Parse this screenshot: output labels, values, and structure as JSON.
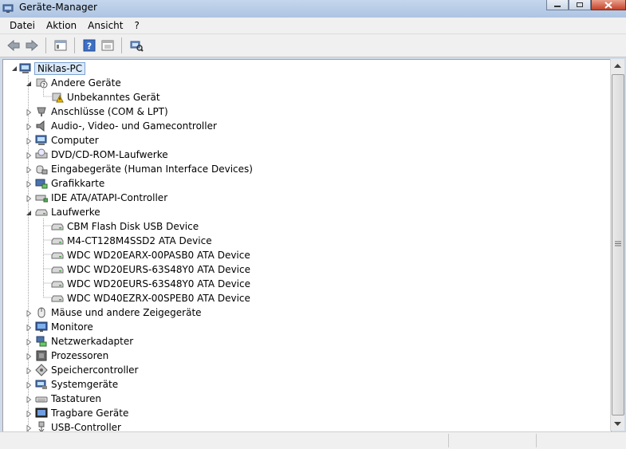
{
  "window": {
    "title": "Geräte-Manager"
  },
  "menu": [
    "Datei",
    "Aktion",
    "Ansicht",
    "?"
  ],
  "toolbar": {
    "buttons": [
      "back-icon",
      "forward-icon",
      "properties-icon",
      "help-icon",
      "show-hidden-icon",
      "scan-hardware-icon"
    ]
  },
  "tree": {
    "root": "Niklas-PC",
    "items": [
      {
        "label": "Andere Geräte",
        "level": 1,
        "expanded": true,
        "icon": "unknown-device-icon"
      },
      {
        "label": "Unbekanntes Gerät",
        "level": 2,
        "icon": "warning-device-icon"
      },
      {
        "label": "Anschlüsse (COM & LPT)",
        "level": 1,
        "expanded": false,
        "icon": "port-icon"
      },
      {
        "label": "Audio-, Video- und Gamecontroller",
        "level": 1,
        "expanded": false,
        "icon": "speaker-icon"
      },
      {
        "label": "Computer",
        "level": 1,
        "expanded": false,
        "icon": "computer-icon"
      },
      {
        "label": "DVD/CD-ROM-Laufwerke",
        "level": 1,
        "expanded": false,
        "icon": "dvd-drive-icon"
      },
      {
        "label": "Eingabegeräte (Human Interface Devices)",
        "level": 1,
        "expanded": false,
        "icon": "hid-icon"
      },
      {
        "label": "Grafikkarte",
        "level": 1,
        "expanded": false,
        "icon": "display-adapter-icon"
      },
      {
        "label": "IDE ATA/ATAPI-Controller",
        "level": 1,
        "expanded": false,
        "icon": "ide-controller-icon"
      },
      {
        "label": "Laufwerke",
        "level": 1,
        "expanded": true,
        "icon": "disk-drive-icon"
      },
      {
        "label": "CBM Flash Disk USB Device",
        "level": 2,
        "icon": "disk-drive-icon"
      },
      {
        "label": "M4-CT128M4SSD2 ATA Device",
        "level": 2,
        "icon": "disk-drive-icon"
      },
      {
        "label": "WDC WD20EARX-00PASB0 ATA Device",
        "level": 2,
        "icon": "disk-drive-icon"
      },
      {
        "label": "WDC WD20EURS-63S48Y0 ATA Device",
        "level": 2,
        "icon": "disk-drive-icon"
      },
      {
        "label": "WDC WD20EURS-63S48Y0 ATA Device",
        "level": 2,
        "icon": "disk-drive-icon"
      },
      {
        "label": "WDC WD40EZRX-00SPEB0 ATA Device",
        "level": 2,
        "icon": "disk-drive-icon"
      },
      {
        "label": "Mäuse und andere Zeigegeräte",
        "level": 1,
        "expanded": false,
        "icon": "mouse-icon"
      },
      {
        "label": "Monitore",
        "level": 1,
        "expanded": false,
        "icon": "monitor-icon"
      },
      {
        "label": "Netzwerkadapter",
        "level": 1,
        "expanded": false,
        "icon": "network-adapter-icon"
      },
      {
        "label": "Prozessoren",
        "level": 1,
        "expanded": false,
        "icon": "processor-icon"
      },
      {
        "label": "Speichercontroller",
        "level": 1,
        "expanded": false,
        "icon": "storage-controller-icon"
      },
      {
        "label": "Systemgeräte",
        "level": 1,
        "expanded": false,
        "icon": "system-device-icon"
      },
      {
        "label": "Tastaturen",
        "level": 1,
        "expanded": false,
        "icon": "keyboard-icon"
      },
      {
        "label": "Tragbare Geräte",
        "level": 1,
        "expanded": false,
        "icon": "portable-device-icon"
      },
      {
        "label": "USB-Controller",
        "level": 1,
        "expanded": false,
        "icon": "usb-icon"
      }
    ]
  }
}
